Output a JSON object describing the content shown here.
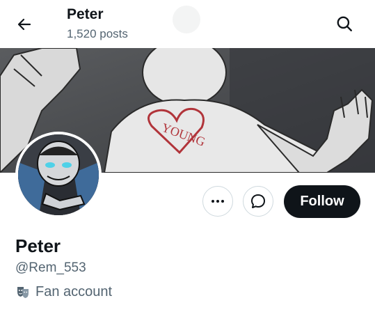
{
  "header": {
    "name": "Peter",
    "post_count": "1,520 posts",
    "back_icon": "arrow-left-icon",
    "search_icon": "search-icon"
  },
  "banner": {
    "description_icon": "banner-image",
    "heart_text": "YOUNG"
  },
  "profile": {
    "display_name": "Peter",
    "handle": "@Rem_553",
    "category": "Fan account",
    "category_icon": "theater-masks-icon"
  },
  "actions": {
    "more_icon": "more-dots-icon",
    "message_icon": "message-bubble-icon",
    "follow_label": "Follow"
  },
  "colors": {
    "text_primary": "#0f1419",
    "text_secondary": "#536471",
    "follow_bg": "#0f1419",
    "border": "#cfd9de",
    "heart_stroke": "#b1343a"
  }
}
